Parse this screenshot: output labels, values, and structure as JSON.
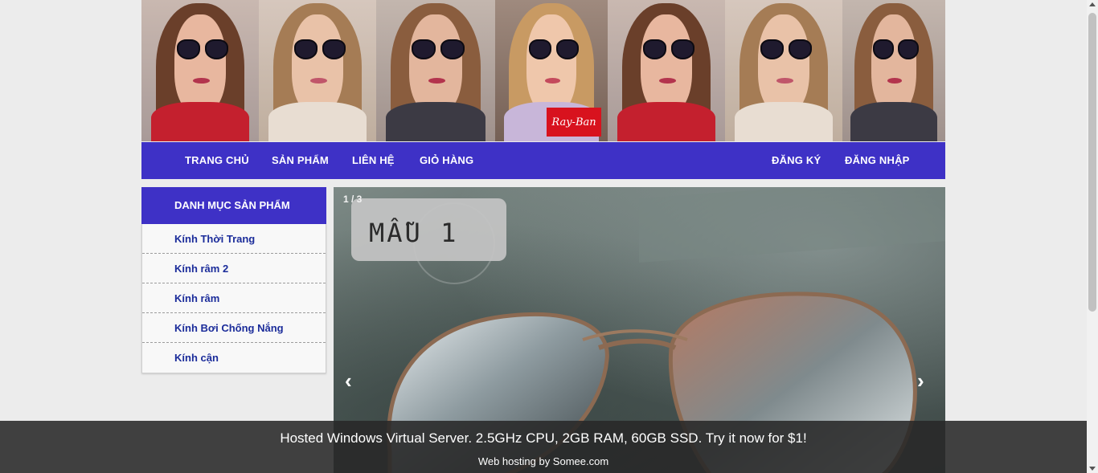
{
  "banner": {
    "brand_logo_text": "Ray-Ban"
  },
  "nav": {
    "left": [
      "TRANG CHỦ",
      "SẢN PHẨM",
      "LIÊN HỆ",
      "GIỎ HÀNG"
    ],
    "right": [
      "ĐĂNG KÝ",
      "ĐĂNG NHẬP"
    ]
  },
  "sidebar": {
    "title": "DANH MỤC SẢN PHẨM",
    "items": [
      "Kính Thời Trang",
      "Kính râm 2",
      "Kính râm",
      "Kính Bơi Chống Nắng",
      "Kính cận"
    ]
  },
  "slider": {
    "counter": "1 / 3",
    "label": "MẪU 1",
    "prev_icon": "chevron-left-icon",
    "next_icon": "chevron-right-icon"
  },
  "footer": {
    "ad_text": "Hosted Windows Virtual Server. 2.5GHz CPU, 2GB RAM, 60GB SSD. Try it now for $1!",
    "hosting_text": "Web hosting by Somee.com"
  },
  "colors": {
    "accent": "#3e31c6",
    "category_text": "#1b2c9a",
    "footer_bg": "#282828"
  }
}
